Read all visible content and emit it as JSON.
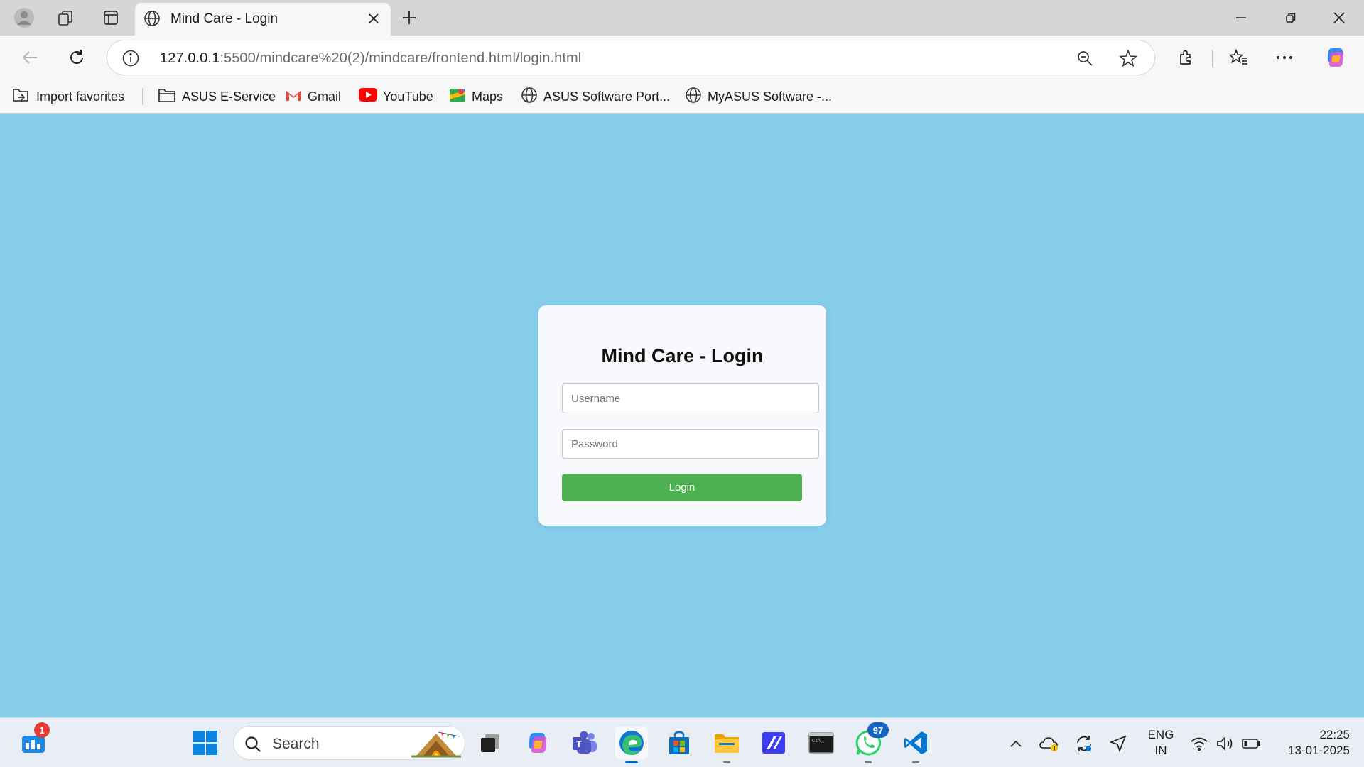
{
  "browser": {
    "tab_title": "Mind Care - Login",
    "url_host": "127.0.0.1",
    "url_rest": ":5500/mindcare%20(2)/mindcare/frontend.html/login.html"
  },
  "bookmarks": [
    {
      "label": "Import favorites",
      "icon": "import-icon"
    },
    {
      "label": "ASUS E-Service",
      "icon": "folder-icon"
    },
    {
      "label": "Gmail",
      "icon": "gmail-icon"
    },
    {
      "label": "YouTube",
      "icon": "youtube-icon"
    },
    {
      "label": "Maps",
      "icon": "maps-icon"
    },
    {
      "label": "ASUS Software Port...",
      "icon": "globe-icon"
    },
    {
      "label": "MyASUS Software -...",
      "icon": "globe-icon"
    }
  ],
  "login": {
    "title": "Mind Care - Login",
    "username_placeholder": "Username",
    "password_placeholder": "Password",
    "button_label": "Login",
    "button_color": "#4caf50",
    "page_background": "#87ceeb"
  },
  "taskbar": {
    "search_label": "Search",
    "widgets_badge": "1",
    "whatsapp_badge": "97",
    "lang_line1": "ENG",
    "lang_line2": "IN",
    "time": "22:25",
    "date": "13-01-2025"
  }
}
